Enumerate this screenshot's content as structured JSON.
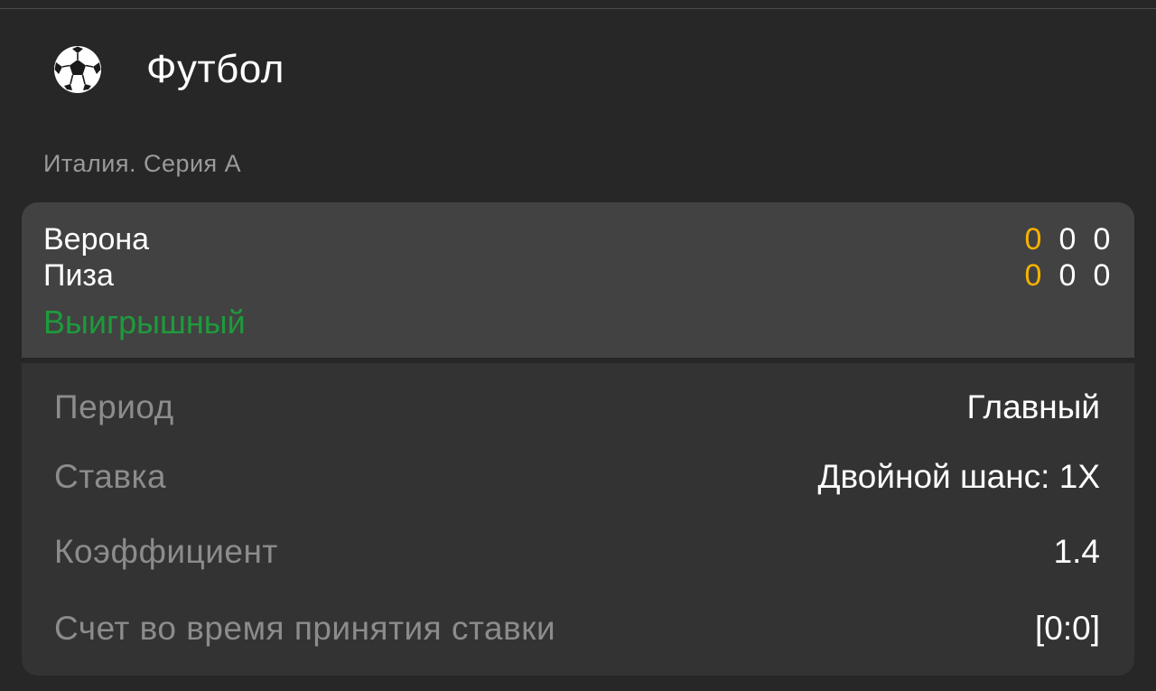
{
  "header": {
    "icon": "soccer-ball-icon",
    "title": "Футбол"
  },
  "league": "Италия. Серия А",
  "match": {
    "team1": {
      "name": "Верона",
      "scores": [
        "0",
        "0",
        "0"
      ]
    },
    "team2": {
      "name": "Пиза",
      "scores": [
        "0",
        "0",
        "0"
      ]
    },
    "status": "Выигрышный",
    "status_color": "#1e9a3c",
    "accent_score_color": "#f5b300"
  },
  "details": [
    {
      "label": "Период",
      "value": "Главный"
    },
    {
      "label": "Ставка",
      "value": "Двойной шанс: 1X"
    },
    {
      "label": "Коэффициент",
      "value": "1.4"
    },
    {
      "label": "Счет во время принятия ставки",
      "value": "[0:0]"
    }
  ]
}
